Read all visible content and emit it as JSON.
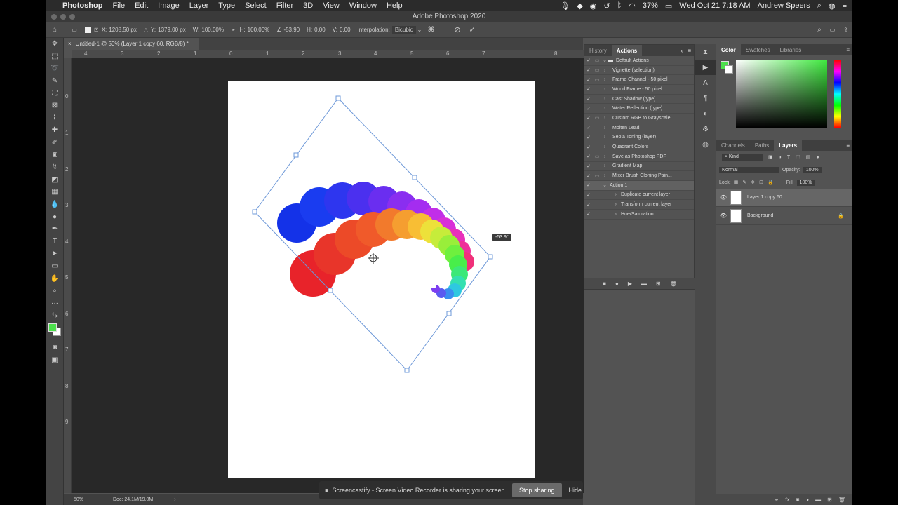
{
  "menubar": {
    "app": "Photoshop",
    "items": [
      "File",
      "Edit",
      "Image",
      "Layer",
      "Type",
      "Select",
      "Filter",
      "3D",
      "View",
      "Window",
      "Help"
    ],
    "battery": "37%",
    "clock": "Wed Oct 21  7:18 AM",
    "user": "Andrew Speers"
  },
  "window": {
    "title": "Adobe Photoshop 2020"
  },
  "options": {
    "x_label": "X:",
    "x_value": "1208.50 px",
    "y_label": "Y:",
    "y_value": "1379.00 px",
    "w_label": "W:",
    "w_value": "100.00%",
    "h_label": "H:",
    "h_value": "100.00%",
    "angle_value": "-53.90",
    "hskew_label": "H:",
    "hskew_value": "0.00",
    "vskew_label": "V:",
    "vskew_value": "0.00",
    "interp_label": "Interpolation:",
    "interp_value": "Bicubic"
  },
  "document": {
    "tab_title": "Untitled-1 @ 50% (Layer 1 copy 60, RGB/8) *",
    "zoom": "50%",
    "doc_size": "Doc: 24.1M/19.0M",
    "angle_tooltip": "-53.9°"
  },
  "ruler": {
    "h_ticks": [
      "4",
      "3",
      "2",
      "1",
      "0",
      "1",
      "2",
      "3",
      "4",
      "5",
      "6",
      "7",
      "8"
    ],
    "v_ticks": [
      "0",
      "1",
      "2",
      "3",
      "4",
      "5",
      "6",
      "7",
      "8",
      "9"
    ]
  },
  "share": {
    "message": "Screencastify - Screen Video Recorder is sharing your screen.",
    "stop_label": "Stop sharing",
    "hide_label": "Hide"
  },
  "actions_panel": {
    "tabs": [
      "History",
      "Actions"
    ],
    "set_name": "Default Actions",
    "items": [
      "Vignette (selection)",
      "Frame Channel - 50 pixel",
      "Wood Frame - 50 pixel",
      "Cast Shadow (type)",
      "Water Reflection (type)",
      "Custom RGB to Grayscale",
      "Molten Lead",
      "Sepia Toning (layer)",
      "Quadrant Colors",
      "Save as Photoshop PDF",
      "Gradient Map",
      "Mixer Brush Cloning Pain..."
    ],
    "action_name": "Action 1",
    "steps": [
      "Duplicate current layer",
      "Transform current layer",
      "Hue/Saturation"
    ]
  },
  "color_panel": {
    "tabs": [
      "Color",
      "Swatches",
      "Libraries"
    ],
    "foreground": "#4ce04c"
  },
  "layers_panel": {
    "tabs": [
      "Channels",
      "Paths",
      "Layers"
    ],
    "filter": "Kind",
    "blend_mode": "Normal",
    "opacity_label": "Opacity:",
    "opacity_value": "100%",
    "lock_label": "Lock:",
    "fill_label": "Fill:",
    "fill_value": "100%",
    "layers": [
      "Layer 1 copy 60",
      "Background"
    ]
  }
}
